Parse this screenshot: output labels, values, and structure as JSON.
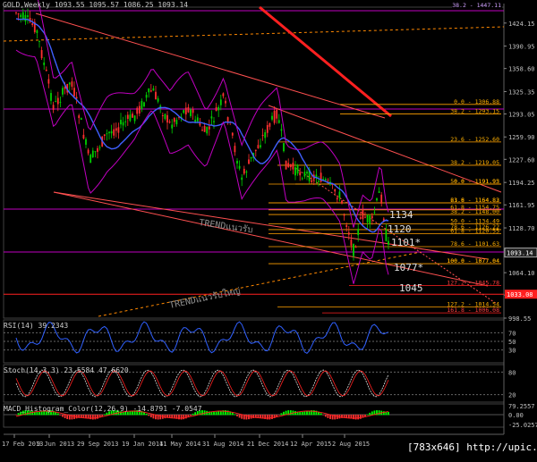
{
  "window": {
    "title": "GOLD,Weekly",
    "ohlc": "1093.55 1095.57 1086.25 1093.14",
    "watermark": "[783x646] http://upic.me/"
  },
  "colors": {
    "background": "#000000",
    "bull": "#00d000",
    "bear": "#ff3030",
    "bollinger": "#c000c0",
    "ma": "#4060ff",
    "fib_line": "#ffa000",
    "fib_label": "#ffb000",
    "trend_red": "#ff2020",
    "macd_hist": "#00ff00",
    "signal": "#ff2020"
  },
  "price_axis": {
    "ticks": [
      "1424.15",
      "1390.95",
      "1358.60",
      "1325.35",
      "1293.05",
      "1259.90",
      "1227.60",
      "1194.25",
      "1161.95",
      "1128.70",
      "1096.40",
      "1064.10",
      "1031.90",
      "998.55"
    ],
    "current_price": "1093.14",
    "red_tag": "1033.08",
    "top_clip": "38.2 - 1447.11"
  },
  "date_axis": {
    "labels": [
      "17 Feb 2013",
      "9 Jun 2013",
      "29 Sep 2013",
      "19 Jan 2014",
      "11 May 2014",
      "31 Aug 2014",
      "21 Dec 2014",
      "12 Apr 2015",
      "2 Aug 2015"
    ]
  },
  "fib_labels": [
    "0.0 - 1306.88",
    "38.2 - 1293.15",
    "23.6 - 1252.60",
    "38.2 - 1219.05",
    "0.0 - 1191.95",
    "50.0 - 1191.93",
    "23.6 - 1164.83",
    "61.8 - 1164.82",
    "38.2 - 1148.00",
    "61.8 - 1154.75",
    "50.0 - 1134.49",
    "78.6 - 1126.22",
    "61.8 - 1120.55",
    "78.6 - 1101.63",
    "100.0 - 1077.04",
    "100.0 - 1077.04",
    "127.2 - 1045.78",
    "127.2 - 1014.54",
    "161.8 - 1006.08"
  ],
  "annotations": [
    "1134",
    "1120",
    "1101*",
    "1077*",
    "1045"
  ],
  "trend_labels": [
    "TRENDแนวรับ",
    "TRENDแนวรับใหญ่"
  ],
  "rsi": {
    "label": "RSI(14) 39.2343",
    "levels": [
      "70",
      "50",
      "30"
    ]
  },
  "stoch": {
    "label": "Stoch(14,3,3) 23.5584 47.6620",
    "levels": [
      "80",
      "20"
    ]
  },
  "macd": {
    "label": "MACD_Histogram_Color(12,26,9) -14.8791 -7.0547",
    "axis": [
      "79.2557",
      "0.00",
      "-25.0257"
    ]
  }
}
